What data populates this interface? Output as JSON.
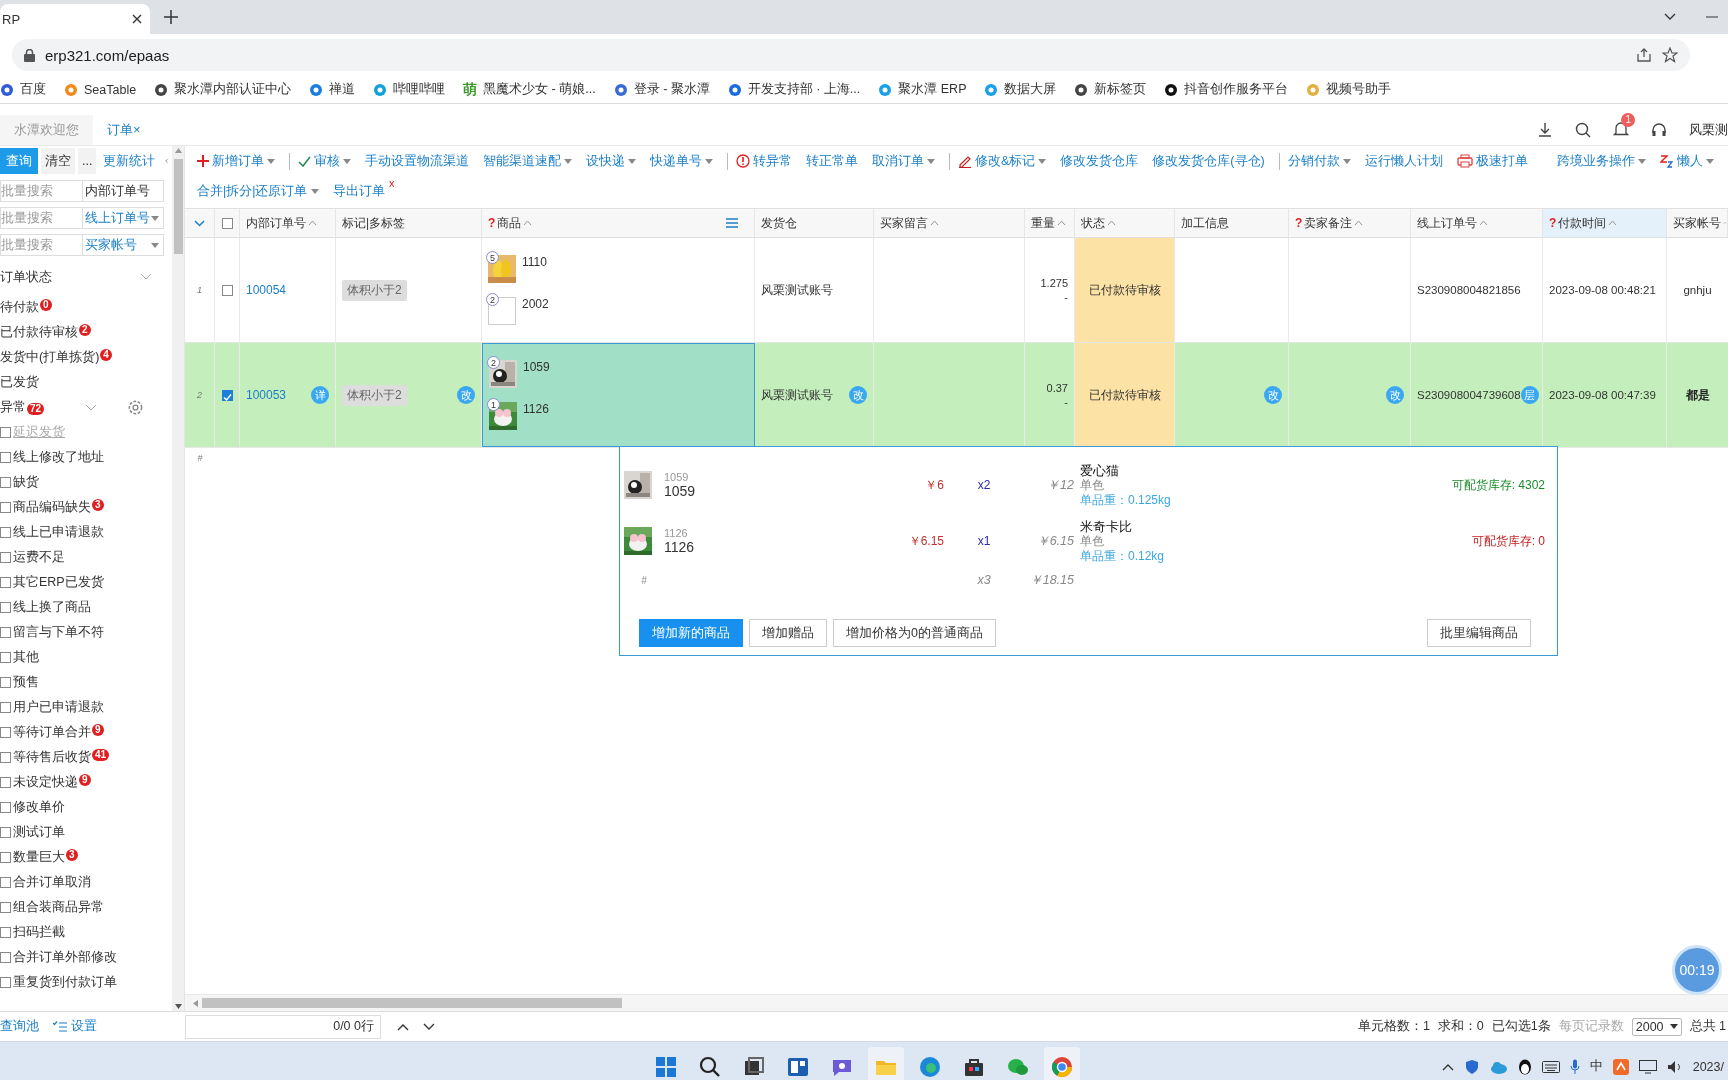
{
  "browser": {
    "tab_title": "RP",
    "url": "erp321.com/epaas",
    "bookmarks": [
      {
        "label": "百度"
      },
      {
        "label": "SeaTable"
      },
      {
        "label": "聚水潭内部认证中心"
      },
      {
        "label": "禅道"
      },
      {
        "label": "哔哩哔哩"
      },
      {
        "label": "黑魔术少女 - 萌娘...",
        "icon_text": "萌"
      },
      {
        "label": "登录 - 聚水潭"
      },
      {
        "label": "开发支持部 · 上海..."
      },
      {
        "label": "聚水潭 ERP"
      },
      {
        "label": "数据大屏"
      },
      {
        "label": "新标签页"
      },
      {
        "label": "抖音创作服务平台"
      },
      {
        "label": "视频号助手"
      }
    ]
  },
  "app_tabs": [
    {
      "label": "水潭欢迎您",
      "selected": false
    },
    {
      "label": "订单",
      "close": "×",
      "selected": true
    }
  ],
  "header": {
    "notifications": "1",
    "user": "风栗测"
  },
  "sidebar": {
    "buttons": [
      {
        "label": "查询",
        "kind": "primary"
      },
      {
        "label": "清空",
        "kind": "plain"
      },
      {
        "label": "...",
        "kind": "plain"
      },
      {
        "label": "更新统计",
        "kind": "link"
      }
    ],
    "searches": [
      {
        "placeholder": "批量搜索",
        "field": "内部订单号",
        "dropdown": false
      },
      {
        "placeholder": "批量搜索",
        "field": "线上订单号",
        "dropdown": true
      },
      {
        "placeholder": "批量搜索",
        "field": "买家帐号",
        "dropdown": true
      }
    ],
    "status_title": "订单状态",
    "items": [
      {
        "kind": "status",
        "label": "待付款",
        "count": "0"
      },
      {
        "kind": "status",
        "label": "已付款待审核",
        "count": "2"
      },
      {
        "kind": "status",
        "label": "发货中(打单拣货)",
        "count": "4"
      },
      {
        "kind": "status",
        "label": "已发货"
      },
      {
        "kind": "group",
        "label": "异常",
        "count": "72"
      },
      {
        "kind": "check",
        "label": "延迟发货",
        "checked": false,
        "disabled": true
      },
      {
        "kind": "check",
        "label": "线上修改了地址",
        "checked": false,
        "disabled": false
      },
      {
        "kind": "check",
        "label": "缺货",
        "checked": false,
        "disabled": false
      },
      {
        "kind": "check",
        "label": "商品编码缺失",
        "count": "3",
        "checked": false,
        "disabled": false
      },
      {
        "kind": "check",
        "label": "线上已申请退款",
        "checked": false,
        "disabled": false
      },
      {
        "kind": "check",
        "label": "运费不足",
        "checked": false,
        "disabled": false
      },
      {
        "kind": "check",
        "label": "其它ERP已发货",
        "checked": false,
        "disabled": false
      },
      {
        "kind": "check",
        "label": "线上换了商品",
        "checked": false,
        "disabled": false
      },
      {
        "kind": "check",
        "label": "留言与下单不符",
        "checked": false,
        "disabled": false
      },
      {
        "kind": "check",
        "label": "其他",
        "checked": false,
        "disabled": false
      },
      {
        "kind": "check",
        "label": "预售",
        "checked": false,
        "disabled": false
      },
      {
        "kind": "check",
        "label": "用户已申请退款",
        "checked": false,
        "disabled": false
      },
      {
        "kind": "check",
        "label": "等待订单合并",
        "count": "9",
        "checked": false,
        "disabled": false
      },
      {
        "kind": "check",
        "label": "等待售后收货",
        "count": "41",
        "checked": false,
        "disabled": false
      },
      {
        "kind": "check",
        "label": "未设定快递",
        "count": "9",
        "checked": false,
        "disabled": false
      },
      {
        "kind": "check",
        "label": "修改单价",
        "checked": false,
        "disabled": false
      },
      {
        "kind": "check",
        "label": "测试订单",
        "checked": false,
        "disabled": false
      },
      {
        "kind": "check",
        "label": "数量巨大",
        "count": "3",
        "checked": false,
        "disabled": false
      },
      {
        "kind": "check",
        "label": "合并订单取消",
        "checked": false,
        "disabled": false
      },
      {
        "kind": "check",
        "label": "组合装商品异常",
        "checked": false,
        "disabled": false
      },
      {
        "kind": "check",
        "label": "扫码拦截",
        "checked": false,
        "disabled": false
      },
      {
        "kind": "check",
        "label": "合并订单外部修改",
        "checked": false,
        "disabled": false
      },
      {
        "kind": "check",
        "label": "重复货到付款订单",
        "checked": false,
        "disabled": false
      }
    ],
    "footer": [
      {
        "label": "查询池",
        "kind": "link"
      },
      {
        "label": "设置",
        "kind": "settings"
      }
    ]
  },
  "toolbar": {
    "rows": [
      [
        {
          "label": "新增订单",
          "kind": "plus",
          "caret": true
        },
        {
          "label": "审核",
          "kind": "check",
          "caret": true,
          "sep": true
        },
        {
          "label": "手动设置物流渠道",
          "caret": false
        },
        {
          "label": "智能渠道速配",
          "caret": true
        },
        {
          "label": "设快递",
          "caret": true
        },
        {
          "label": "快递单号",
          "caret": true
        },
        {
          "label": "转异常",
          "kind": "warn",
          "caret": false,
          "sep": true
        },
        {
          "label": "转正常单",
          "caret": false
        },
        {
          "label": "取消订单",
          "caret": true
        },
        {
          "label": "修改&标记",
          "kind": "pen",
          "caret": true,
          "sep": true
        },
        {
          "label": "修改发货仓库",
          "caret": false
        },
        {
          "label": "修改发货仓库(寻仓)",
          "caret": false
        },
        {
          "label": "分销付款",
          "caret": true,
          "sep": true
        },
        {
          "label": "运行懒人计划",
          "caret": false
        },
        {
          "label": "极速打单",
          "kind": "printer",
          "caret": false
        }
      ],
      [
        {
          "label": "合并|拆分|还原订单",
          "caret": true
        },
        {
          "label": "导出订单",
          "caret": false,
          "mark": "x"
        }
      ]
    ],
    "right": [
      {
        "label": "跨境业务操作",
        "caret": true
      },
      {
        "label": "懒人",
        "kind": "zz",
        "caret": true
      }
    ]
  },
  "table": {
    "select_all": false,
    "columns": [
      {
        "label": "内部订单号",
        "sortable": true
      },
      {
        "label": "标记|多标签",
        "sortable": false
      },
      {
        "label": "商品",
        "hint": "?",
        "sortable": true
      },
      {
        "label": "发货仓",
        "sortable": false
      },
      {
        "label": "买家留言",
        "sortable": true
      },
      {
        "label": "重量",
        "sortable": true
      },
      {
        "label": "状态",
        "sortable": true
      },
      {
        "label": "加工信息",
        "sortable": false
      },
      {
        "label": "卖家备注",
        "hint": "?",
        "sortable": true
      },
      {
        "label": "线上订单号",
        "sortable": true
      },
      {
        "label": "付款时间",
        "hint": "?",
        "sortable": true
      },
      {
        "label": "买家帐号",
        "sortable": true
      }
    ],
    "rows": [
      {
        "index": "1",
        "selected": false,
        "id": "100054",
        "tag": "体积小于2",
        "goods": [
          {
            "qty": "5",
            "code": "1110",
            "kind": "picture"
          },
          {
            "qty": "2",
            "code": "2002",
            "kind": "empty"
          }
        ],
        "warehouse": "风栗测试账号",
        "weight": "1.275",
        "weight_sub": "-",
        "status": "已付款待审核",
        "online_id": "S230908004821856",
        "paid_at": "2023-09-08 00:48:21",
        "buyer": "gnhju"
      },
      {
        "index": "2",
        "selected": true,
        "id": "100053",
        "id_badge": "详",
        "tag": "体积小于2",
        "tag_badge": "改",
        "goods": [
          {
            "qty": "2",
            "code": "1059",
            "kind": "picture"
          },
          {
            "qty": "1",
            "code": "1126",
            "kind": "picture"
          }
        ],
        "warehouse": "风栗测试账号",
        "warehouse_badge": "改",
        "weight": "0.37",
        "weight_sub": "-",
        "status": "已付款待审核",
        "process_badge": "改",
        "remark_badge": "改",
        "online_id": "S230908004739608",
        "online_badge": "层",
        "paid_at": "2023-09-08 00:47:39",
        "buyer": "都是"
      }
    ],
    "footer_mark": "#"
  },
  "popup": {
    "items": [
      {
        "sku": "1059",
        "code": "1059",
        "price": "￥6",
        "qty": "x2",
        "total": "￥12",
        "name": "爱心猫",
        "spec": "单色",
        "unit_weight": "单品重：0.125kg",
        "stock": "可配货库存: 4302",
        "in_stock": true
      },
      {
        "sku": "1126",
        "code": "1126",
        "price": "￥6.15",
        "qty": "x1",
        "total": "￥6.15",
        "name": "米奇卡比",
        "spec": "单色",
        "unit_weight": "单品重：0.12kg",
        "stock": "可配货库存: 0",
        "in_stock": false
      }
    ],
    "summary": {
      "mark": "#",
      "qty": "x3",
      "total": "￥18.15"
    },
    "buttons": [
      {
        "label": "增加新的商品",
        "kind": "primary"
      },
      {
        "label": "增加赠品",
        "kind": "plain"
      },
      {
        "label": "增加价格为0的普通商品",
        "kind": "plain"
      },
      {
        "label": "批里编辑商品",
        "kind": "right"
      }
    ]
  },
  "status_bar": {
    "pager": "0/0 0行",
    "cells": "单元格数：1",
    "sum": "求和：0",
    "checked": "已勾选1条",
    "page_size_label": "每页记录数",
    "page_size": "2000",
    "total": "总共 1"
  },
  "timer": "00:19",
  "taskbar": {
    "ime": "中",
    "clock": "2023/"
  }
}
